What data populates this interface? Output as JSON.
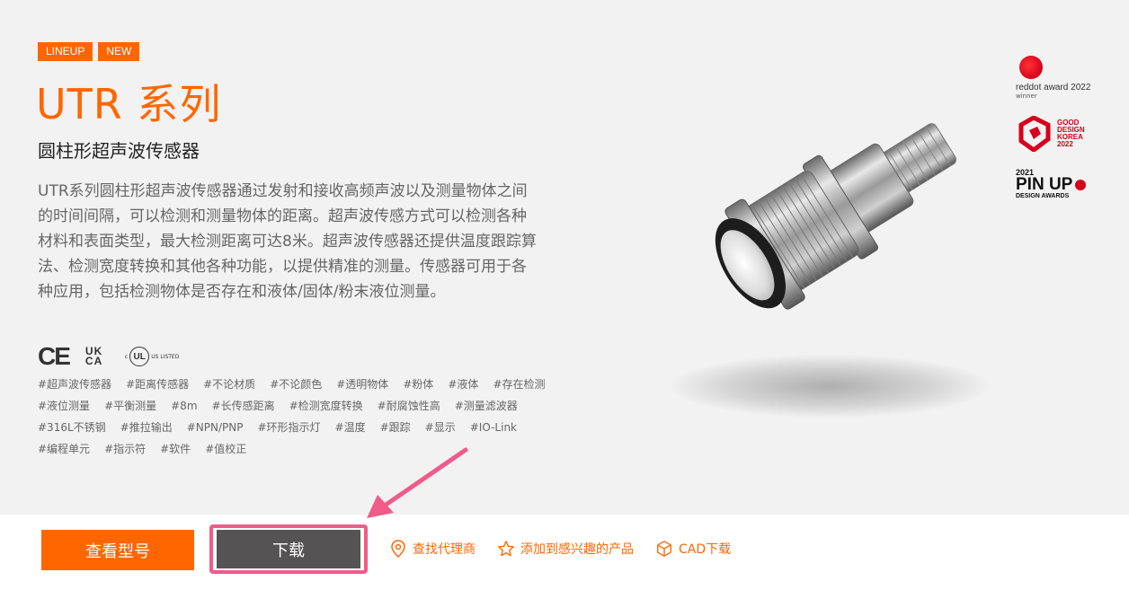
{
  "badges": [
    "LINEUP",
    "NEW"
  ],
  "title": "UTR 系列",
  "subtitle": "圆柱形超声波传感器",
  "description": "UTR系列圆柱形超声波传感器通过发射和接收高频声波以及测量物体之间的时间间隔，可以检测和测量物体的距离。超声波传感方式可以检测各种材料和表面类型，最大检测距离可达8米。超声波传感器还提供温度跟踪算法、检测宽度转换和其他各种功能，以提供精准的测量。传感器可用于各种应用，包括检测物体是否存在和液体/固体/粉末液位测量。",
  "certifications": {
    "ce": "CE",
    "ukca": "UK CA",
    "cul_mark": "UL",
    "cul_c": "c",
    "cul_listed": "US LISTED"
  },
  "tags": [
    "#超声波传感器",
    "#距离传感器",
    "#不论材质",
    "#不论颜色",
    "#透明物体",
    "#粉体",
    "#液体",
    "#存在检测",
    "#液位测量",
    "#平衡测量",
    "#8m",
    "#长传感距离",
    "#检测宽度转换",
    "#耐腐蚀性高",
    "#测量滤波器",
    "#316L不锈钢",
    "#推拉输出",
    "#NPN/PNP",
    "#环形指示灯",
    "#温度",
    "#跟踪",
    "#显示",
    "#IO-Link",
    "#编程单元",
    "#指示符",
    "#软件",
    "#值校正"
  ],
  "awards": {
    "reddot": {
      "title": "reddot award 2022",
      "sub": "winner"
    },
    "good_design": [
      "GOOD",
      "DESIGN",
      "KOREA",
      "2022"
    ],
    "pinup": {
      "year": "2021",
      "main": "PIN UP",
      "sub": "DESIGN AWARDS"
    }
  },
  "actions": {
    "view_models": "查看型号",
    "download": "下载",
    "find_agent": "查找代理商",
    "add_favorite": "添加到感兴趣的产品",
    "cad_download": "CAD下载"
  },
  "colors": {
    "accent": "#ff6600",
    "download_button": "#555354",
    "highlight": "#f25a8a"
  }
}
